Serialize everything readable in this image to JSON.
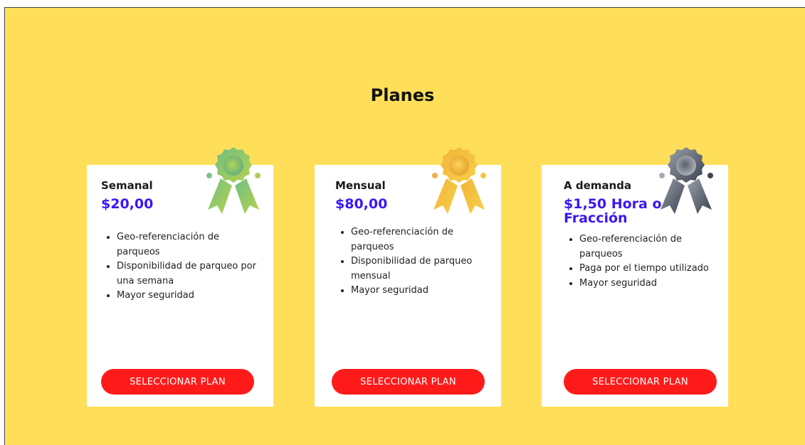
{
  "section_title": "Planes",
  "plans": [
    {
      "name": "Semanal",
      "price": "$20,00",
      "features": [
        "Geo-referenciación de parqueos",
        "Disponibilidad de parqueo por una semana",
        "Mayor seguridad"
      ],
      "button_label": "SELECCIONAR PLAN",
      "badge_icon": "green-award-ribbon-icon"
    },
    {
      "name": "Mensual",
      "price": "$80,00",
      "features": [
        "Geo-referenciación de parqueos",
        "Disponibilidad de parqueo mensual",
        "Mayor seguridad"
      ],
      "button_label": "SELECCIONAR PLAN",
      "badge_icon": "gold-award-ribbon-icon"
    },
    {
      "name": "A demanda",
      "price": "$1,50 Hora o Fracción",
      "features": [
        "Geo-referenciación de parqueos",
        "Paga por el tiempo utilizado",
        "Mayor seguridad"
      ],
      "button_label": "SELECCIONAR PLAN",
      "badge_icon": "gray-award-ribbon-icon"
    }
  ],
  "colors": {
    "background": "#ffdf5a",
    "card": "#ffffff",
    "price": "#3b17f2",
    "button": "#ff1a1a"
  }
}
